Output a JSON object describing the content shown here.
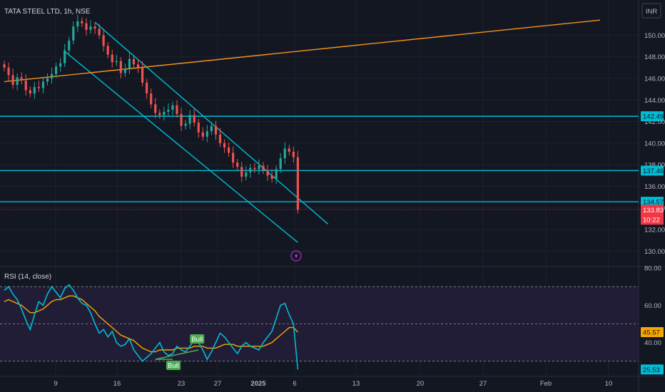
{
  "header": {
    "title": "TATA STEEL LTD, 1h, NSE"
  },
  "currency": {
    "label": "INR"
  },
  "rsi_panel": {
    "title": "RSI (14, close)"
  },
  "colors": {
    "background": "#131722",
    "grid": "#1e222d",
    "up": "#26a69a",
    "down": "#ef5350",
    "channel": "#00bcd4",
    "trendline": "#f7931a",
    "rsi": "#00bcd4",
    "rsi_ma": "#f7a600",
    "rsi_band": "#241f3a",
    "bull": "#4caf50",
    "price_tag": "#f23645"
  },
  "chart_data": [
    {
      "type": "candlestick",
      "title": "TATA STEEL LTD, 1h, NSE",
      "ylim": [
        128.7,
        152.6
      ],
      "y_ticks": [
        "130.00",
        "132.00",
        "134.00",
        "136.00",
        "138.00",
        "140.00",
        "142.00",
        "144.00",
        "146.00",
        "148.00",
        "150.00"
      ],
      "x_ticks": [
        "9",
        "16",
        "23",
        "27",
        "2025",
        "6",
        "13",
        "20",
        "27",
        "Feb",
        "10"
      ],
      "horizontal_lines": [
        {
          "value": 142.49,
          "label": "142.49"
        },
        {
          "value": 137.46,
          "label": "137.46"
        },
        {
          "value": 134.57,
          "label": "134.57"
        }
      ],
      "current_price": {
        "value": 133.83,
        "label": "133.83",
        "countdown": "10:22"
      },
      "trendline": {
        "from": [
          0,
          145.7
        ],
        "to": [
          138,
          151.4
        ]
      },
      "channel_upper": {
        "from": [
          21,
          151.2
        ],
        "to": [
          75,
          132.5
        ]
      },
      "channel_lower": {
        "from": [
          14,
          148.5
        ],
        "to": [
          68,
          130.8
        ]
      },
      "series": [
        {
          "name": "price",
          "values": [
            147.0,
            146.3,
            145.4,
            146.1,
            145.8,
            144.9,
            144.6,
            145.2,
            145.1,
            145.7,
            146.0,
            146.4,
            147.1,
            147.4,
            148.6,
            149.5,
            150.8,
            151.3,
            151.1,
            150.5,
            150.8,
            150.6,
            150.0,
            149.0,
            148.2,
            147.5,
            147.6,
            146.5,
            146.9,
            147.8,
            147.3,
            147.0,
            145.6,
            144.6,
            143.6,
            142.8,
            142.6,
            142.9,
            143.1,
            143.5,
            142.7,
            141.6,
            141.8,
            142.6,
            141.9,
            141.0,
            140.6,
            141.1,
            141.6,
            140.8,
            140.0,
            139.6,
            139.1,
            138.2,
            137.8,
            136.9,
            137.3,
            137.7,
            137.6,
            137.9,
            137.5,
            137.0,
            136.7,
            137.6,
            138.6,
            139.5,
            139.2,
            138.7,
            133.83
          ]
        }
      ]
    },
    {
      "type": "line",
      "title": "RSI (14, close)",
      "ylim": [
        23.0,
        80.0
      ],
      "y_ticks": [
        "40.00",
        "60.00",
        "80.00"
      ],
      "bands": [
        30,
        50,
        70
      ],
      "current_labels": {
        "rsi": "25.53",
        "rsi_ma": "45.57"
      },
      "markers": [
        "Bull",
        "Bull"
      ],
      "series": [
        {
          "name": "RSI",
          "values": [
            68,
            70,
            66,
            63,
            58,
            52,
            47,
            55,
            62,
            60,
            66,
            70,
            67,
            64,
            69,
            71,
            68,
            64,
            61,
            60,
            56,
            50,
            45,
            47,
            43,
            46,
            40,
            38,
            39,
            42,
            36,
            33,
            30,
            32,
            34,
            37,
            40,
            35,
            33,
            34,
            38,
            36,
            35,
            38,
            41,
            40,
            36,
            31,
            35,
            40,
            45,
            43,
            40,
            37,
            34,
            38,
            40,
            38,
            37,
            36,
            40,
            43,
            46,
            53,
            60,
            61,
            55,
            50,
            25.53
          ]
        },
        {
          "name": "RSI-based MA",
          "values": [
            62,
            63,
            62,
            61,
            60,
            58,
            56,
            56,
            57,
            58,
            60,
            62,
            63,
            63,
            64,
            65,
            65,
            64,
            63,
            61,
            59,
            57,
            54,
            52,
            50,
            48,
            46,
            44,
            43,
            42,
            41,
            39,
            37,
            36,
            35,
            35,
            36,
            36,
            36,
            36,
            37,
            37,
            37,
            37,
            38,
            38,
            38,
            37,
            37,
            37,
            38,
            39,
            39,
            39,
            38,
            38,
            38,
            38,
            38,
            38,
            38,
            39,
            40,
            42,
            44,
            46,
            48,
            48,
            45.57
          ]
        }
      ]
    }
  ]
}
